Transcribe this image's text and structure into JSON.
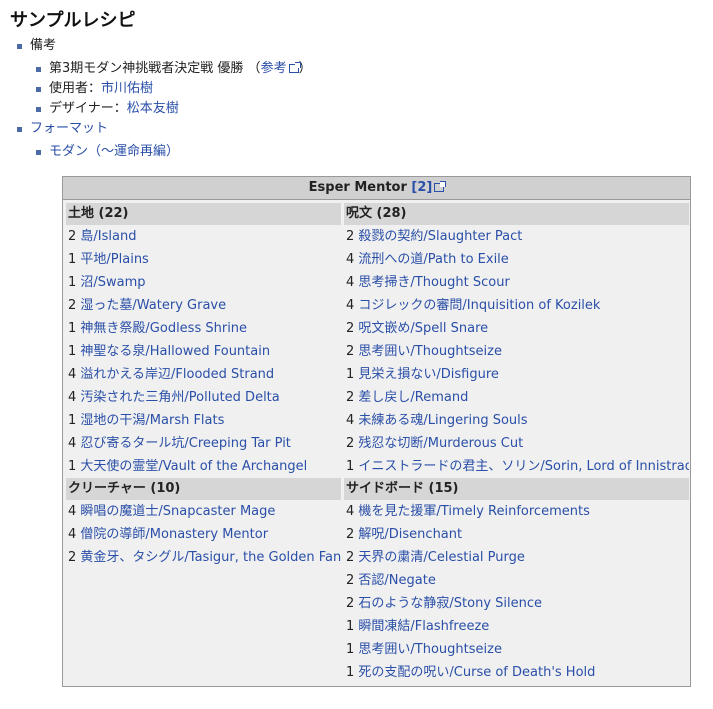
{
  "heading": "サンプルレシピ",
  "notes_label": "備考",
  "event": {
    "name": "第3期モダン神挑戦者決定戦 優勝",
    "ref_open": "（",
    "ref_link": "参考",
    "ref_close": "）"
  },
  "player": {
    "label": "使用者：",
    "name": "市川佑樹"
  },
  "designer": {
    "label": "デザイナー：",
    "name": "松本友樹"
  },
  "format_label": "フォーマット",
  "format_value": "モダン（～運命再編）",
  "deck": {
    "title": "Esper Mentor",
    "ref": "[2]",
    "lands": {
      "header": "土地 (22)",
      "cards": [
        {
          "q": "2",
          "n": "島/Island"
        },
        {
          "q": "1",
          "n": "平地/Plains"
        },
        {
          "q": "1",
          "n": "沼/Swamp"
        },
        {
          "q": "2",
          "n": "湿った墓/Watery Grave"
        },
        {
          "q": "1",
          "n": "神無き祭殿/Godless Shrine"
        },
        {
          "q": "1",
          "n": "神聖なる泉/Hallowed Fountain"
        },
        {
          "q": "4",
          "n": "溢れかえる岸辺/Flooded Strand"
        },
        {
          "q": "4",
          "n": "汚染された三角州/Polluted Delta"
        },
        {
          "q": "1",
          "n": "湿地の干潟/Marsh Flats"
        },
        {
          "q": "4",
          "n": "忍び寄るタール坑/Creeping Tar Pit"
        },
        {
          "q": "1",
          "n": "大天使の霊堂/Vault of the Archangel"
        }
      ]
    },
    "creatures": {
      "header": "クリーチャー (10)",
      "cards": [
        {
          "q": "4",
          "n": "瞬唱の魔道士/Snapcaster Mage"
        },
        {
          "q": "4",
          "n": "僧院の導師/Monastery Mentor"
        },
        {
          "q": "2",
          "n": "黄金牙、タシグル/Tasigur, the Golden Fang"
        }
      ]
    },
    "spells": {
      "header": "呪文 (28)",
      "cards": [
        {
          "q": "2",
          "n": "殺戮の契約/Slaughter Pact"
        },
        {
          "q": "4",
          "n": "流刑への道/Path to Exile"
        },
        {
          "q": "4",
          "n": "思考掃き/Thought Scour"
        },
        {
          "q": "4",
          "n": "コジレックの審問/Inquisition of Kozilek"
        },
        {
          "q": "2",
          "n": "呪文嵌め/Spell Snare"
        },
        {
          "q": "2",
          "n": "思考囲い/Thoughtseize"
        },
        {
          "q": "1",
          "n": "見栄え損ない/Disfigure"
        },
        {
          "q": "2",
          "n": "差し戻し/Remand"
        },
        {
          "q": "4",
          "n": "未練ある魂/Lingering Souls"
        },
        {
          "q": "2",
          "n": "残忍な切断/Murderous Cut"
        },
        {
          "q": "1",
          "n": "イニストラードの君主、ソリン/Sorin, Lord of Innistrad"
        }
      ]
    },
    "sideboard": {
      "header": "サイドボード (15)",
      "cards": [
        {
          "q": "4",
          "n": "機を見た援軍/Timely Reinforcements"
        },
        {
          "q": "2",
          "n": "解呪/Disenchant"
        },
        {
          "q": "2",
          "n": "天界の粛清/Celestial Purge"
        },
        {
          "q": "2",
          "n": "否認/Negate"
        },
        {
          "q": "2",
          "n": "石のような静寂/Stony Silence"
        },
        {
          "q": "1",
          "n": "瞬間凍結/Flashfreeze"
        },
        {
          "q": "1",
          "n": "思考囲い/Thoughtseize"
        },
        {
          "q": "1",
          "n": "死の支配の呪い/Curse of Death's Hold"
        }
      ]
    }
  }
}
